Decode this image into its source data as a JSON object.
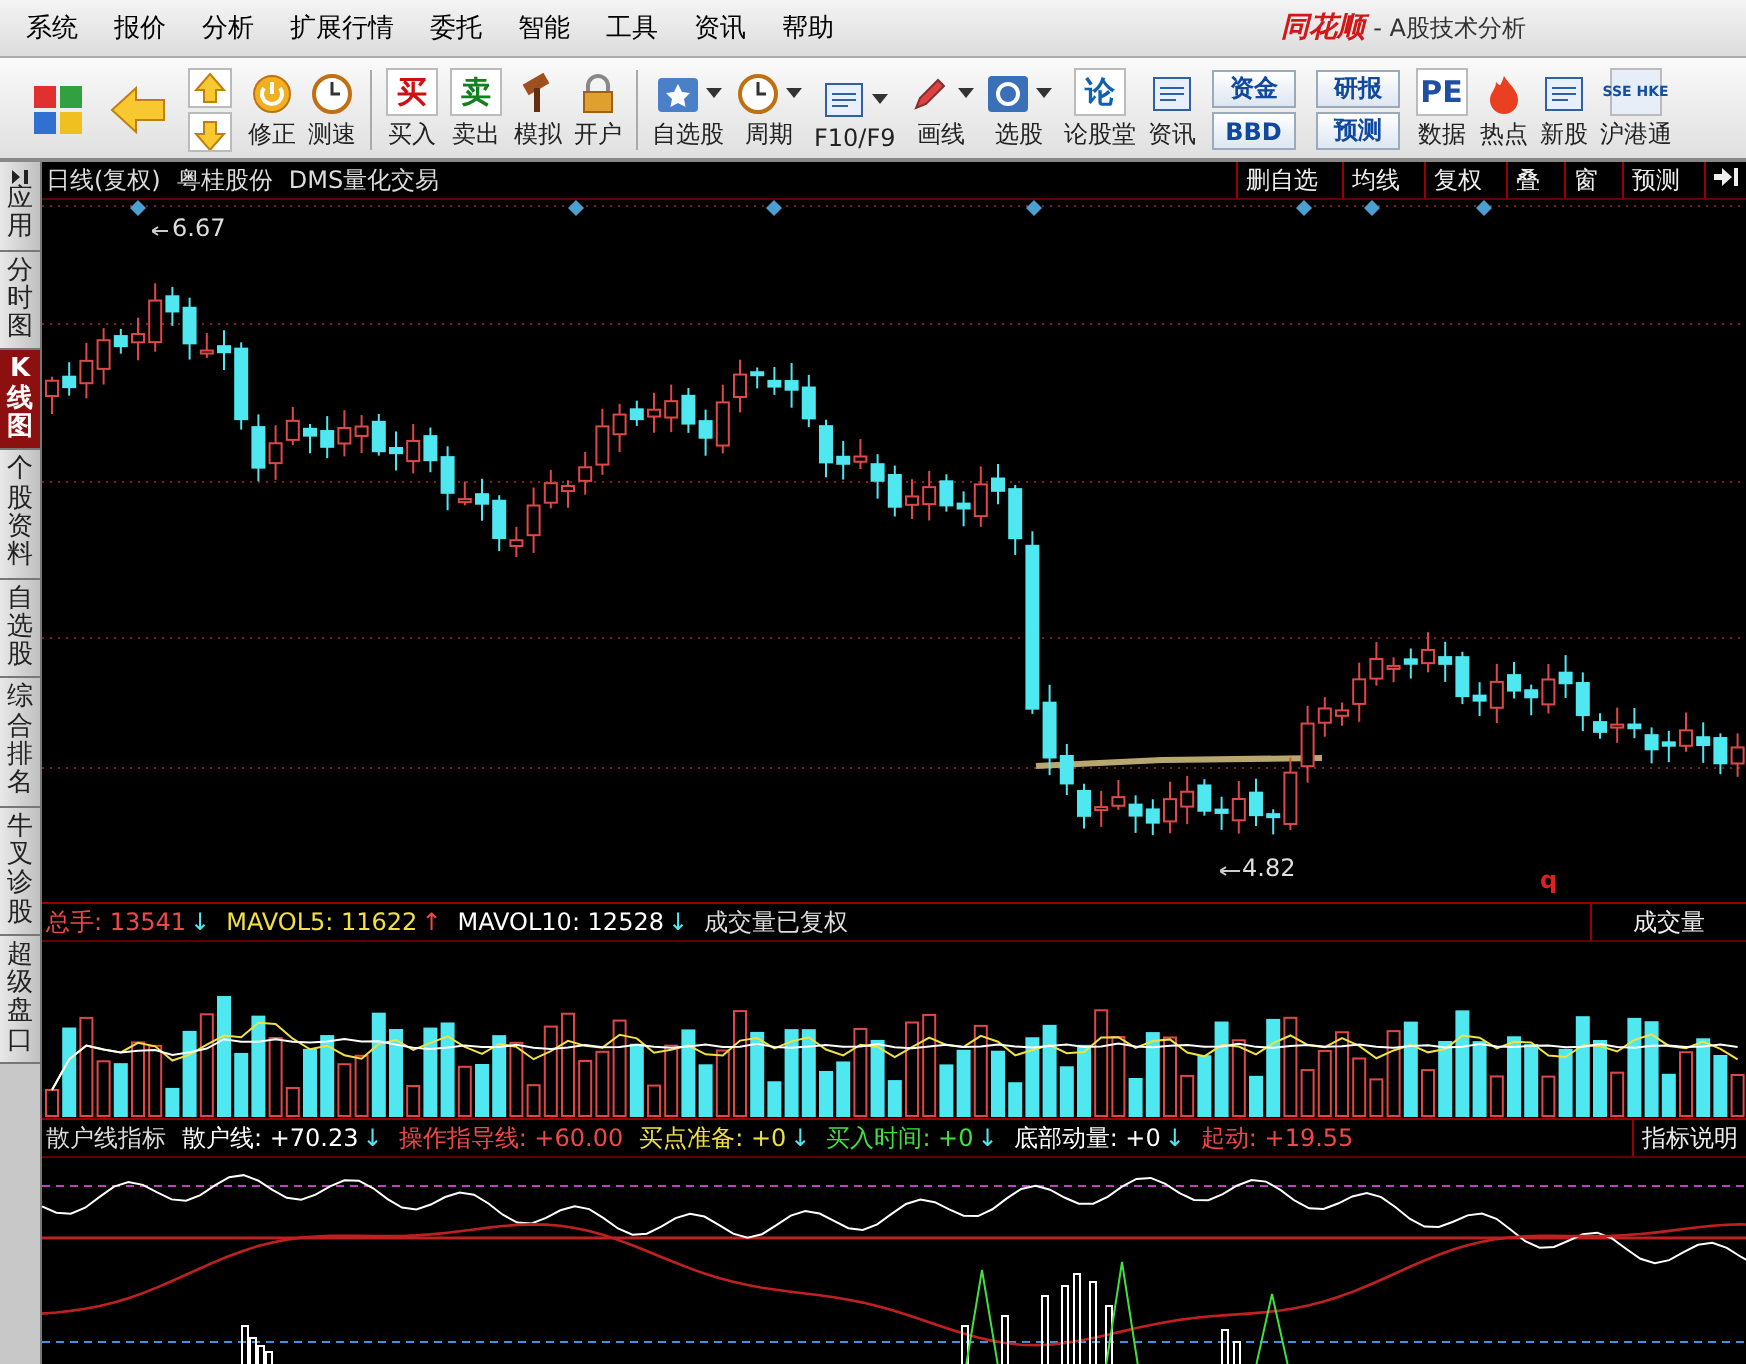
{
  "menu": [
    "系统",
    "报价",
    "分析",
    "扩展行情",
    "委托",
    "智能",
    "工具",
    "资讯",
    "帮助"
  ],
  "app": {
    "logo": "同花顺",
    "title": "- A股技术分析"
  },
  "toolbar": [
    {
      "kind": "logo"
    },
    {
      "kind": "back"
    },
    {
      "kind": "updown"
    },
    {
      "kind": "tool",
      "label": "修正"
    },
    {
      "kind": "tool",
      "label": "测速"
    },
    {
      "kind": "sep"
    },
    {
      "kind": "glyph",
      "glyph": "买",
      "label": "买入"
    },
    {
      "kind": "glyph",
      "glyph": "卖",
      "label": "卖出"
    },
    {
      "kind": "tool",
      "label": "模拟"
    },
    {
      "kind": "tool",
      "label": "开户"
    },
    {
      "kind": "sep"
    },
    {
      "kind": "dropdown",
      "label": "自选股"
    },
    {
      "kind": "dropdown",
      "label": "周期"
    },
    {
      "kind": "dropdown",
      "label": "F10/F9"
    },
    {
      "kind": "dropdown",
      "label": "画线"
    },
    {
      "kind": "dropdown",
      "label": "选股"
    },
    {
      "kind": "glyph",
      "glyph": "论",
      "label": "论股堂"
    },
    {
      "kind": "tool",
      "label": "资讯"
    },
    {
      "kind": "stack",
      "labels": [
        "资金",
        "BBD"
      ]
    },
    {
      "kind": "stack",
      "labels": [
        "研报",
        "预测"
      ]
    },
    {
      "kind": "glyph",
      "glyph": "PE",
      "label": "数据"
    },
    {
      "kind": "tool",
      "label": "热点"
    },
    {
      "kind": "tool",
      "label": "新股"
    },
    {
      "kind": "glyph",
      "glyph": "SSE HKE",
      "label": "沪港通"
    }
  ],
  "side_tabs": [
    {
      "label": "应用",
      "selected": false
    },
    {
      "label": "分时图",
      "selected": false
    },
    {
      "label": "K线图",
      "selected": true
    },
    {
      "label": "个股资料",
      "selected": false
    },
    {
      "label": "自选股",
      "selected": false
    },
    {
      "label": "综合排名",
      "selected": false
    },
    {
      "label": "牛叉诊股",
      "selected": false
    },
    {
      "label": "超级盘口",
      "selected": false
    }
  ],
  "chart": {
    "period": "日线(复权)",
    "stock": "粤桂股份",
    "formula": "DMS量化交易",
    "buttons": [
      "删自选",
      "均线",
      "复权",
      "叠",
      "窗",
      "预测"
    ],
    "high_label": "6.67",
    "low_label": "4.82",
    "mark": "q"
  },
  "volume": {
    "legend": [
      {
        "label": "总手:",
        "value": "13541",
        "arrow": "↓"
      },
      {
        "label": "MAVOL5:",
        "value": "11622",
        "arrow": "↑"
      },
      {
        "label": "MAVOL10:",
        "value": "12528",
        "arrow": "↓"
      }
    ],
    "note": "成交量已复权",
    "button": "成交量"
  },
  "indicator": {
    "name": "散户线指标",
    "legend": [
      {
        "label": "散户线:",
        "value": "+70.23",
        "arrow": "↓"
      },
      {
        "label": "操作指导线:",
        "value": "+60.00"
      },
      {
        "label": "买点准备:",
        "value": "+0",
        "arrow": "↓"
      },
      {
        "label": "买入时间:",
        "value": "+0",
        "arrow": "↓"
      },
      {
        "label": "底部动量:",
        "value": "+0",
        "arrow": "↓"
      },
      {
        "label": "起动:",
        "value": "+19.55"
      }
    ],
    "button": "指标说明"
  }
}
